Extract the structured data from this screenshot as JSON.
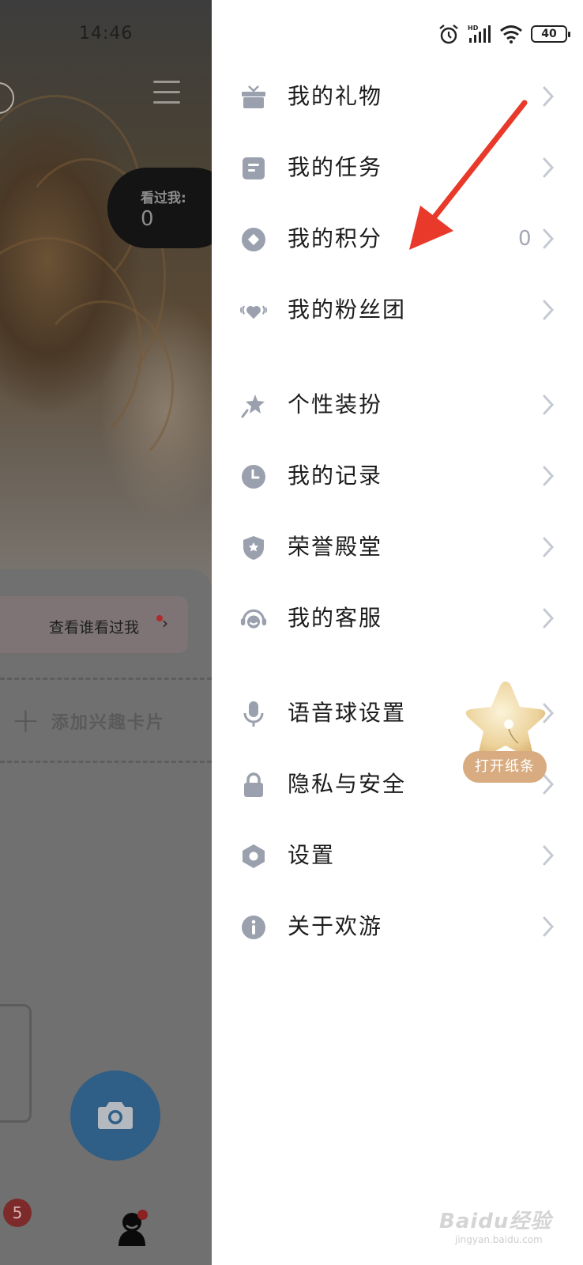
{
  "background": {
    "status_time": "14:46",
    "viewed_label": "看过我:",
    "viewed_count": "0",
    "who_viewed_link": "查看谁看过我",
    "add_interest_card": "添加兴趣卡片",
    "unread_badge": "5"
  },
  "statusbar": {
    "battery": "40",
    "icons": [
      "alarm-icon",
      "hd-signal-icon",
      "wifi-icon",
      "battery-icon"
    ]
  },
  "menu": {
    "gift": {
      "label": "我的礼物",
      "icon": "gift-icon"
    },
    "task": {
      "label": "我的任务",
      "icon": "task-icon"
    },
    "points": {
      "label": "我的积分",
      "value": "0",
      "icon": "points-icon"
    },
    "fan_club": {
      "label": "我的粉丝团",
      "icon": "heart-icon"
    },
    "dress_up": {
      "label": "个性装扮",
      "icon": "magic-star-icon"
    },
    "records": {
      "label": "我的记录",
      "icon": "clock-icon"
    },
    "honor": {
      "label": "荣誉殿堂",
      "icon": "shield-star-icon"
    },
    "service": {
      "label": "我的客服",
      "icon": "headset-icon"
    },
    "voice_ball": {
      "label": "语音球设置",
      "icon": "microphone-icon"
    },
    "privacy": {
      "label": "隐私与安全",
      "icon": "lock-icon"
    },
    "settings": {
      "label": "设置",
      "icon": "hex-gear-icon"
    },
    "about": {
      "label": "关于欢游",
      "icon": "info-icon"
    }
  },
  "floating_widget": {
    "label": "打开纸条",
    "icon": "star-icon"
  },
  "watermark": {
    "text": "Baidu经验",
    "sub": "jingyan.baidu.com"
  },
  "colors": {
    "icon": "#9aa0ae",
    "chevron": "#c5c9d2",
    "annotation_arrow": "#e8392a",
    "camera_button": "#2f5e86"
  }
}
